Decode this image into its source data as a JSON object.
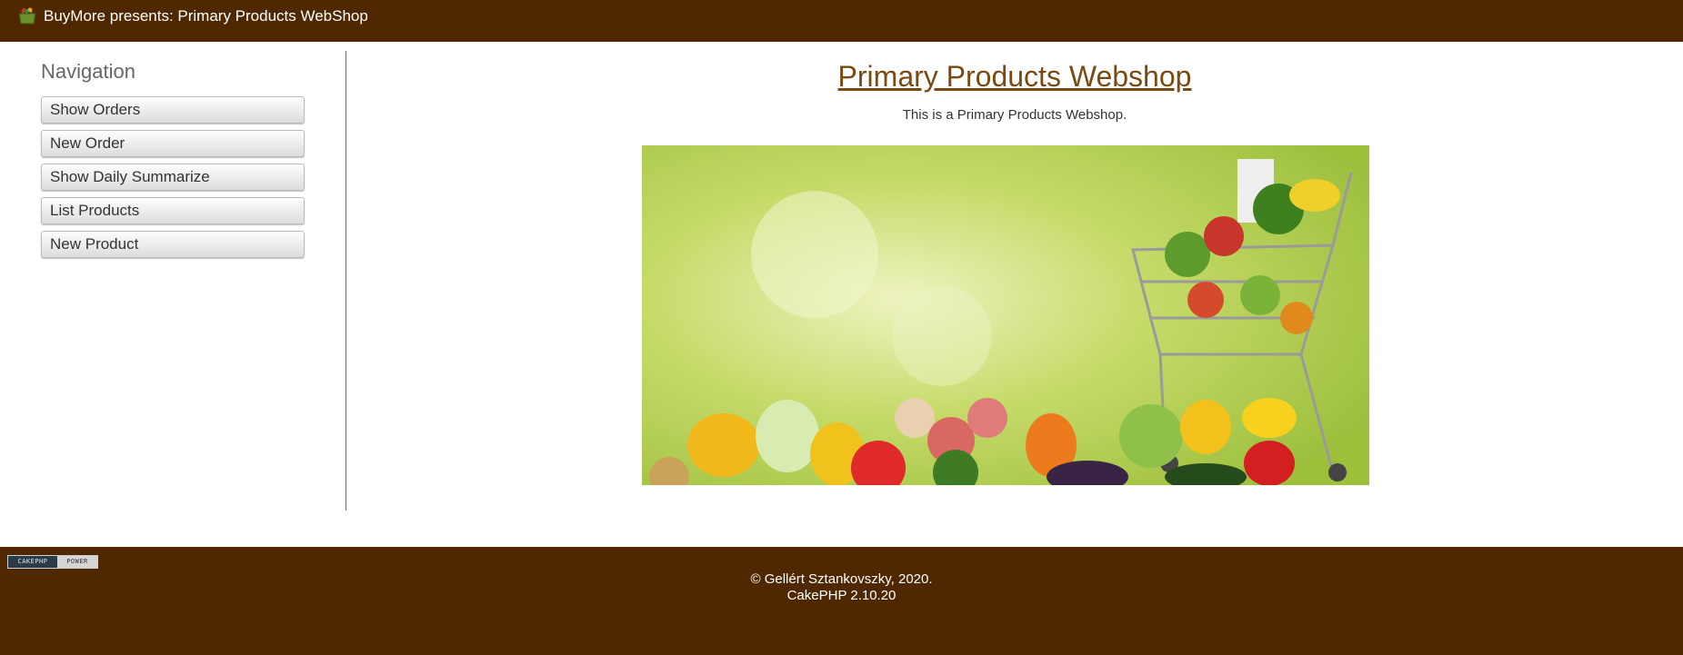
{
  "header": {
    "title": "BuyMore presents: Primary Products WebShop",
    "logo_icon": "basket-icon"
  },
  "sidebar": {
    "heading": "Navigation",
    "items": [
      {
        "label": "Show Orders"
      },
      {
        "label": "New Order"
      },
      {
        "label": "Show Daily Summarize"
      },
      {
        "label": "List Products"
      },
      {
        "label": "New Product"
      }
    ]
  },
  "main": {
    "title": "Primary Products Webshop",
    "intro": "This is a Primary Products Webshop.",
    "hero_image": "shopping-cart-vegetables-image"
  },
  "footer": {
    "powered_badge_left": "CAKEPHP",
    "powered_badge_right": "POWER",
    "copyright": "© Gellért Sztankovszky, 2020.",
    "version": "CakePHP 2.10.20"
  },
  "colors": {
    "header_bg": "#4f2802",
    "link": "#7a4a12",
    "nav_heading": "#666666"
  }
}
